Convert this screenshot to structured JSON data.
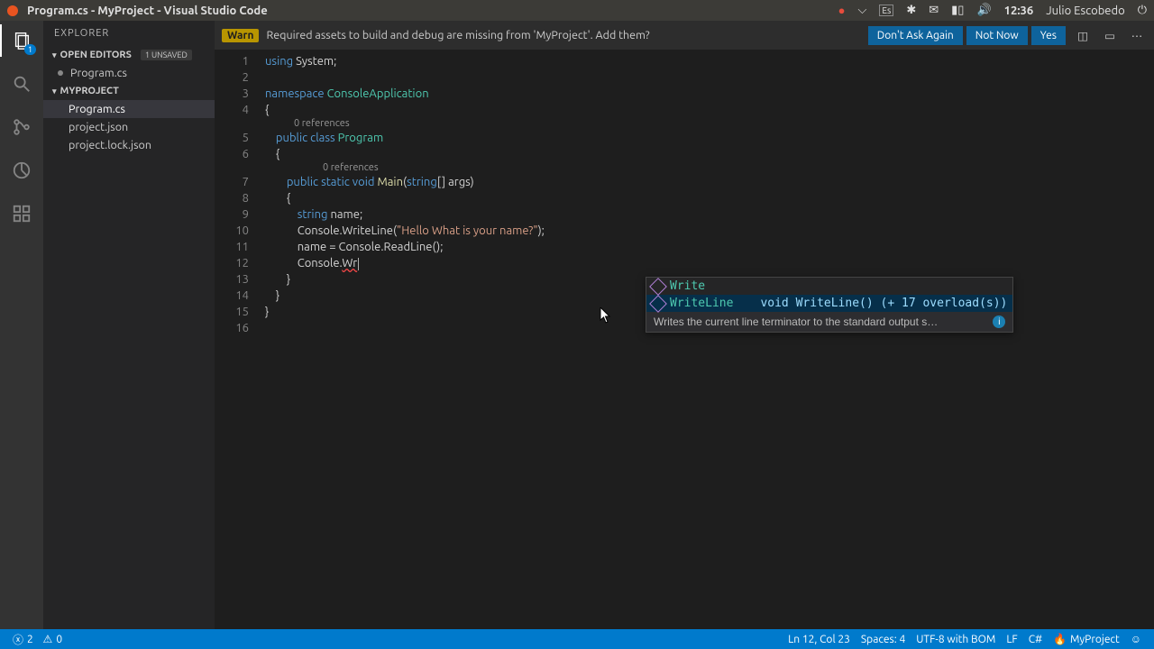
{
  "os": {
    "window_title": "Program.cs - MyProject - Visual Studio Code",
    "keyboard": "Es",
    "time": "12:36",
    "user": "Julio Escobedo"
  },
  "notification": {
    "badge": "Warn",
    "message": "Required assets to build and debug are missing from 'MyProject'. Add them?",
    "buttons": {
      "dont_ask": "Don't Ask Again",
      "not_now": "Not Now",
      "yes": "Yes"
    }
  },
  "sidebar": {
    "title": "EXPLORER",
    "open_editors_label": "OPEN EDITORS",
    "unsaved_badge": "1 UNSAVED",
    "open_editor_item": "Program.cs",
    "project_label": "MYPROJECT",
    "files": [
      "Program.cs",
      "project.json",
      "project.lock.json"
    ]
  },
  "activitybar": {
    "badge": "1"
  },
  "code": {
    "lines": {
      "l1": {
        "kw": "using ",
        "id": "System;"
      },
      "l3": {
        "kw": "namespace ",
        "type": "ConsoleApplication"
      },
      "l4": "{",
      "codelens5": "0 references",
      "l5": {
        "a": "public ",
        "b": "class ",
        "c": "Program"
      },
      "l6": "    {",
      "codelens7": "0 references",
      "l7": {
        "a": "public ",
        "b": "static ",
        "c": "void ",
        "d": "Main",
        "e": "(",
        "f": "string",
        "g": "[] args)"
      },
      "l8": "        {",
      "l9": {
        "a": "string ",
        "b": "name;"
      },
      "l10": {
        "a": "Console.WriteLine(",
        "b": "\"Hello What is your name?\"",
        "c": ");"
      },
      "l11": "name = Console.ReadLine();",
      "l12": {
        "a": "Console.",
        "b": "Wr"
      },
      "l13": "        }",
      "l14": "    }",
      "l15": "}"
    },
    "line_numbers": [
      "1",
      "2",
      "3",
      "4",
      "5",
      "6",
      "7",
      "8",
      "9",
      "10",
      "11",
      "12",
      "13",
      "14",
      "15",
      "16"
    ]
  },
  "suggest": {
    "items": [
      {
        "label": "Write"
      },
      {
        "label": "WriteLine",
        "sig": "void WriteLine() (+ 17 overload(s))"
      }
    ],
    "doc": "Writes the current line terminator to the standard output s…"
  },
  "statusbar": {
    "errors": "2",
    "warnings": "0",
    "position": "Ln 12, Col 23",
    "spaces": "Spaces: 4",
    "encoding": "UTF-8 with BOM",
    "eol": "LF",
    "language": "C#",
    "project": "MyProject",
    "feedback": "☺"
  }
}
